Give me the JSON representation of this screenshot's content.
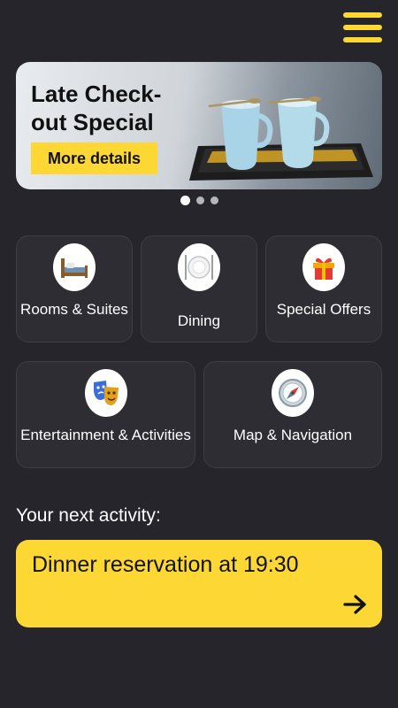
{
  "banner": {
    "title": "Late Check-out Special",
    "button_label": "More details",
    "slides": 3,
    "active_slide": 1
  },
  "categories": [
    {
      "label": "Rooms & Suites",
      "icon": "bed-icon"
    },
    {
      "label": "Dining",
      "icon": "plate-icon"
    },
    {
      "label": "Special Offers",
      "icon": "gift-icon"
    },
    {
      "label": "Entertainment & Activities",
      "icon": "theater-masks-icon"
    },
    {
      "label": "Map & Navigation",
      "icon": "compass-icon"
    }
  ],
  "next_activity": {
    "heading": "Your next activity:",
    "text": "Dinner reservation at 19:30"
  },
  "colors": {
    "background": "#25252b",
    "tile": "#2d2d33",
    "accent": "#fdd835"
  }
}
